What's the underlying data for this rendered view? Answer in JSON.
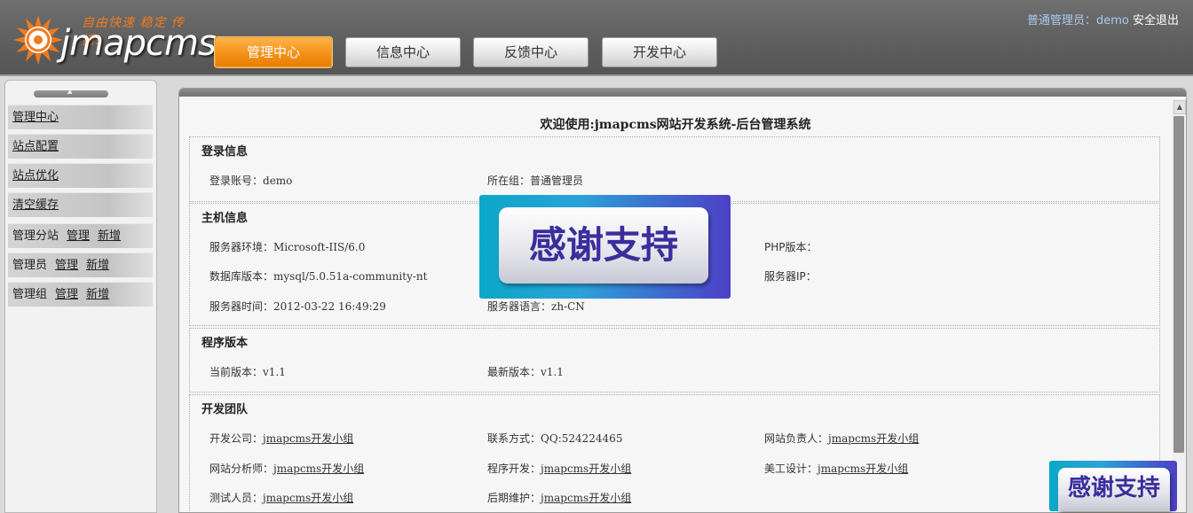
{
  "header": {
    "logo_slogan": "自由快速 稳定 传播!",
    "logo_text": "jmapcms",
    "nav": [
      {
        "label": "管理中心",
        "active": true
      },
      {
        "label": "信息中心",
        "active": false
      },
      {
        "label": "反馈中心",
        "active": false
      },
      {
        "label": "开发中心",
        "active": false
      }
    ],
    "user": {
      "role_prefix": "普通管理员：",
      "username": "demo",
      "logout": "安全退出"
    }
  },
  "sidebar": {
    "items": [
      {
        "label": "管理中心"
      },
      {
        "label": "站点配置"
      },
      {
        "label": "站点优化"
      },
      {
        "label": "清空缓存"
      },
      {
        "label": "管理分站",
        "links": [
          "管理",
          "新增"
        ]
      },
      {
        "label": "管理员",
        "links": [
          "管理",
          "新增"
        ]
      },
      {
        "label": "管理组",
        "links": [
          "管理",
          "新增"
        ]
      }
    ]
  },
  "main": {
    "title": "欢迎使用:jmapcms网站开发系统-后台管理系统",
    "login": {
      "title": "登录信息",
      "account_label": "登录账号：",
      "account_value": "demo",
      "group_label": "所在组：",
      "group_value": "普通管理员"
    },
    "host": {
      "title": "主机信息",
      "server_env_label": "服务器环境：",
      "server_env_value": "Microsoft-IIS/6.0",
      "php_label": "PHP版本：",
      "db_label": "数据库版本：",
      "db_value": "mysql/5.0.51a-community-nt",
      "ip_label": "服务器IP：",
      "time_label": "服务器时间：",
      "time_value": "2012-03-22 16:49:29",
      "lang_label": "服务器语言：",
      "lang_value": "zh-CN"
    },
    "version": {
      "title": "程序版本",
      "current_label": "当前版本：",
      "current_value": "v1.1",
      "latest_label": "最新版本：",
      "latest_value": "v1.1"
    },
    "team": {
      "title": "开发团队",
      "company_label": "开发公司：",
      "company_value": "jmapcms开发小组",
      "contact_label": "联系方式：",
      "contact_value": "QQ:524224465",
      "owner_label": "网站负责人：",
      "owner_value": "jmapcms开发小组",
      "analyst_label": "网站分析师：",
      "analyst_value": "jmapcms开发小组",
      "dev_label": "程序开发：",
      "dev_value": "jmapcms开发小组",
      "art_label": "美工设计：",
      "art_value": "jmapcms开发小组",
      "tester_label": "测试人员：",
      "tester_value": "jmapcms开发小组",
      "maint_label": "后期维护：",
      "maint_value": "jmapcms开发小组"
    }
  },
  "watermark": {
    "text": "感谢支持"
  },
  "colors": {
    "accent_orange": "#f39117",
    "header_bg": "#5e5e5e",
    "watermark_blue": "#3b2d9c"
  }
}
